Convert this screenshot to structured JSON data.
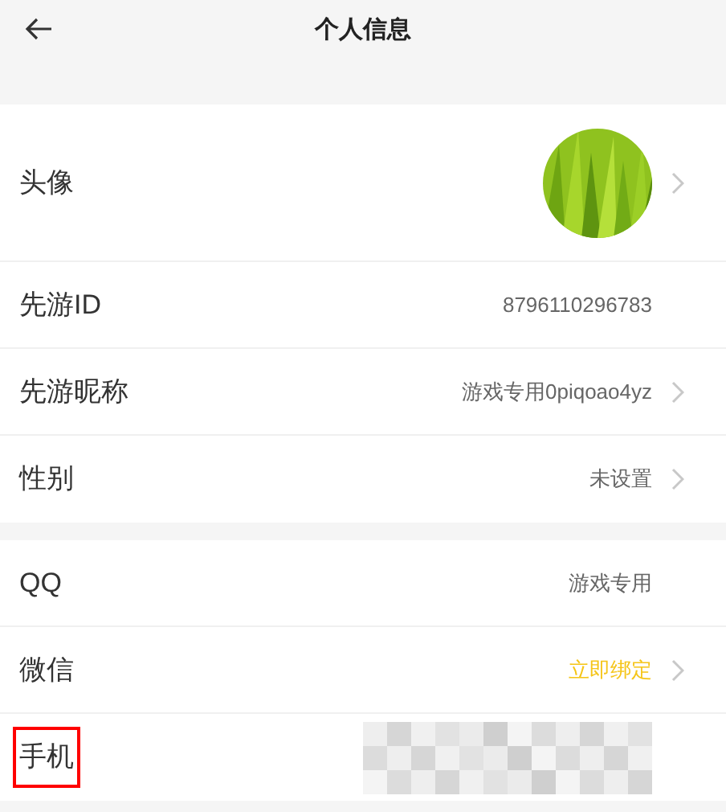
{
  "header": {
    "title": "个人信息"
  },
  "sections": [
    {
      "rows": [
        {
          "kind": "avatar",
          "label": "头像",
          "chevron": true,
          "highlighted": false
        },
        {
          "kind": "text",
          "label": "先游ID",
          "value": "8796110296783",
          "chevron": false,
          "highlighted": false
        },
        {
          "kind": "text",
          "label": "先游昵称",
          "value": "游戏专用0piqoao4yz",
          "chevron": true,
          "highlighted": false
        },
        {
          "kind": "text",
          "label": "性别",
          "value": "未设置",
          "chevron": true,
          "highlighted": false
        }
      ]
    },
    {
      "rows": [
        {
          "kind": "text",
          "label": "QQ",
          "value": "游戏专用",
          "chevron": false,
          "highlighted": false
        },
        {
          "kind": "link",
          "label": "微信",
          "value": "立即绑定",
          "chevron": true,
          "highlighted": false
        },
        {
          "kind": "redacted",
          "label": "手机",
          "chevron": false,
          "highlighted": true
        }
      ]
    }
  ]
}
